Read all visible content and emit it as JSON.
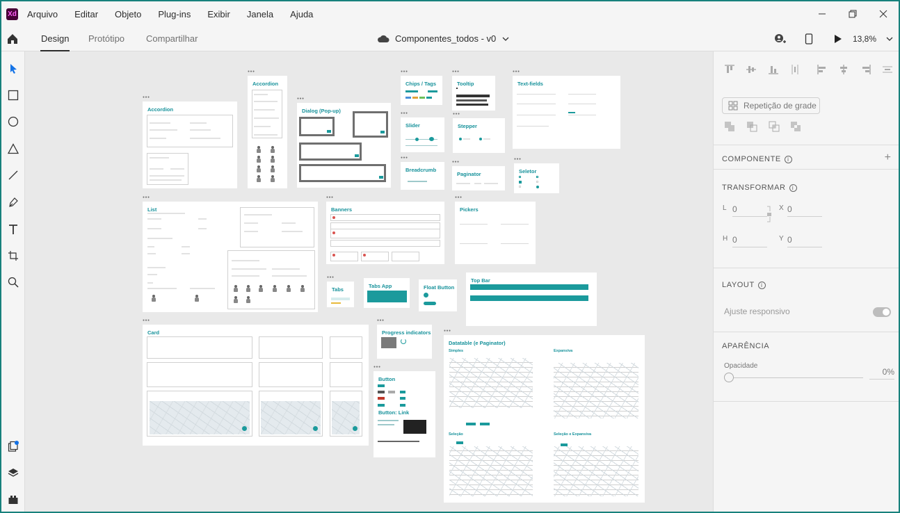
{
  "app": {
    "logo": "Xd",
    "menu": [
      "Arquivo",
      "Editar",
      "Objeto",
      "Plug-ins",
      "Exibir",
      "Janela",
      "Ajuda"
    ]
  },
  "toolbar": {
    "tabs": [
      "Design",
      "Protótipo",
      "Compartilhar"
    ],
    "active_tab": "Design",
    "document_title": "Componentes_todos - v0",
    "zoom": "13,8%"
  },
  "tools": [
    "select-icon",
    "rectangle-icon",
    "ellipse-icon",
    "triangle-icon",
    "line-icon",
    "pen-icon",
    "text-icon",
    "artboard-icon",
    "zoom-icon",
    "assets-icon",
    "layers-icon",
    "plugins-icon"
  ],
  "artboards": {
    "accordion1": "Accordion",
    "accordion2": "Accordion",
    "dialog": "Dialog (Pop-up)",
    "chips": "Chips / Tags",
    "tooltip": "Tooltip",
    "textfields": "Text-fields",
    "slider": "Slider",
    "stepper": "Stepper",
    "breadcrumb": "Breadcrumb",
    "paginator": "Paginator",
    "selector": "Seletor",
    "list": "List",
    "banners": "Banners",
    "pickers": "Pickers",
    "tabs": "Tabs",
    "tabsapp": "Tabs App",
    "floatbutton": "Float Button",
    "topbar": "Top Bar",
    "card": "Card",
    "progress": "Progress indicators",
    "datatable": "Datatable (e Paginator)",
    "button": "Button",
    "buttonlink": "Button: Link",
    "dt_simples": "Simples",
    "dt_expansivo": "Expansiva",
    "dt_selecao": "Seleção",
    "dt_selecao_exp": "Seleção e Expansiva"
  },
  "panel": {
    "grid_repeat": "Repetição de grade",
    "component": "COMPONENTE",
    "transform": "TRANSFORMAR",
    "w_label": "L",
    "w_value": "0",
    "x_label": "X",
    "x_value": "0",
    "h_label": "H",
    "h_value": "0",
    "y_label": "Y",
    "y_value": "0",
    "layout": "LAYOUT",
    "responsive": "Ajuste responsivo",
    "appearance": "APARÊNCIA",
    "opacity_label": "Opacidade",
    "opacity_value": "0%"
  },
  "colors": {
    "accent": "#17929b",
    "frame": "#17817c",
    "xd_logo": "#470137"
  }
}
